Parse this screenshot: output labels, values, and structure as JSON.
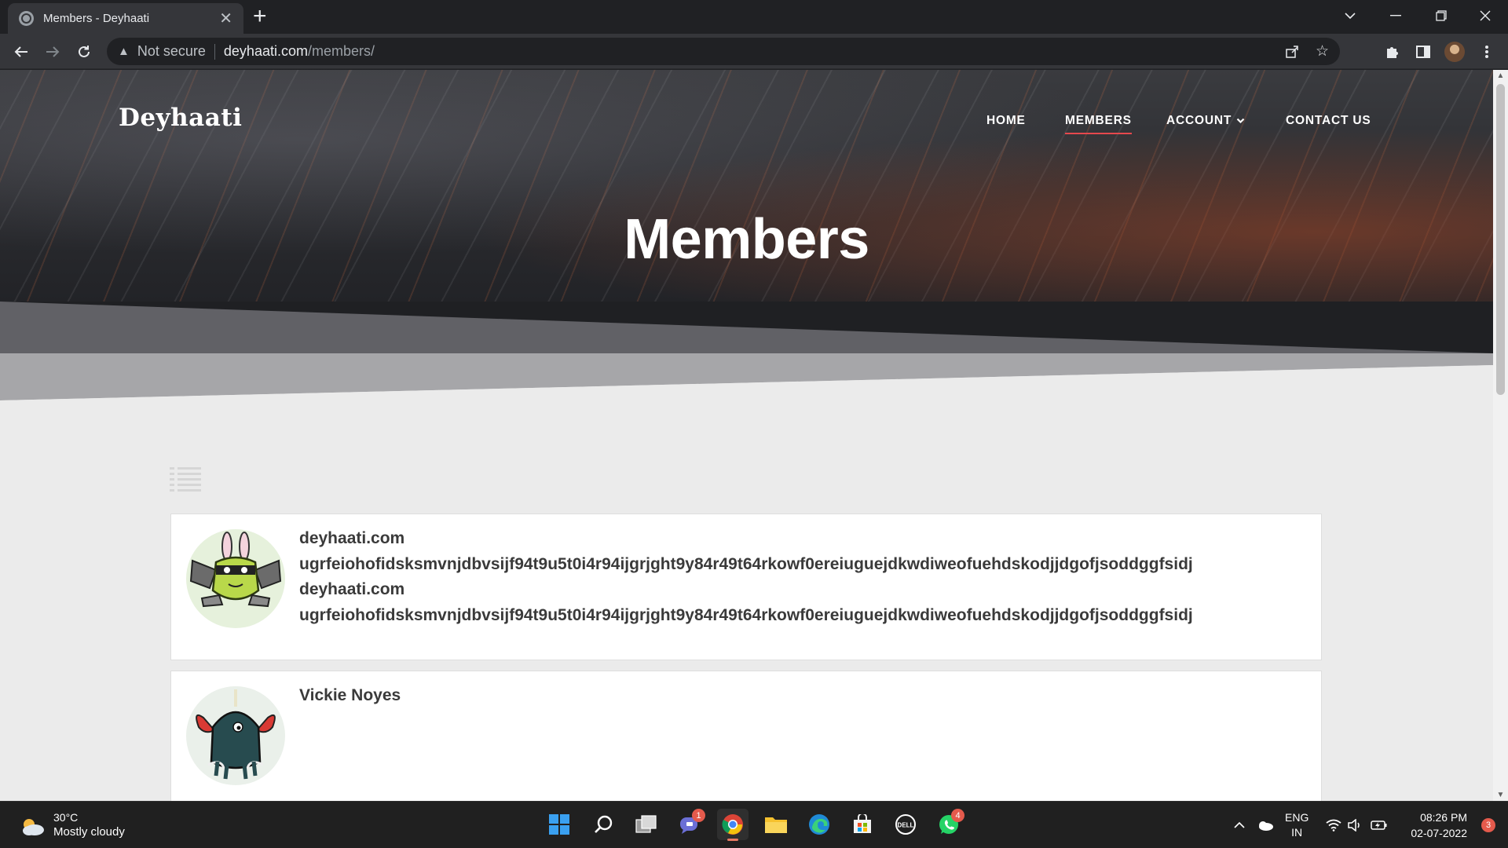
{
  "browser": {
    "tab_title": "Members - Deyhaati",
    "security_label": "Not secure",
    "url_host": "deyhaati.com",
    "url_path": "/members/"
  },
  "site": {
    "brand": "Deyhaati",
    "nav": [
      {
        "label": "HOME",
        "active": false
      },
      {
        "label": "MEMBERS",
        "active": true
      },
      {
        "label": "ACCOUNT",
        "active": false,
        "has_dropdown": true
      },
      {
        "label": "CONTACT US",
        "active": false
      }
    ],
    "page_title": "Members",
    "accent_color": "#e5484d"
  },
  "members": [
    {
      "lines": [
        "deyhaati.com",
        "ugrfeiohofidsksmvnjdbvsijf94t9u5t0i4r94ijgrjght9y84r49t64rkowf0ereiuguejdkwdiweofuehdskodjjdgofjsoddggfsidj",
        "deyhaati.com",
        "ugrfeiohofidsksmvnjdbvsijf94t9u5t0i4r94ijgrjght9y84r49t64rkowf0ereiuguejdkwdiweofuehdskodjjdgofjsoddggfsidj"
      ],
      "avatar_icon": "bat-bunny-monster-avatar"
    },
    {
      "lines": [
        "Vickie Noyes"
      ],
      "avatar_icon": "crab-squid-monster-avatar"
    }
  ],
  "taskbar": {
    "weather_temp": "30°C",
    "weather_condition": "Mostly cloudy",
    "language": "ENG",
    "region": "IN",
    "time": "08:26 PM",
    "date": "02-07-2022",
    "notification_count": "3",
    "teams_badge": "1",
    "whatsapp_badge": "4"
  }
}
